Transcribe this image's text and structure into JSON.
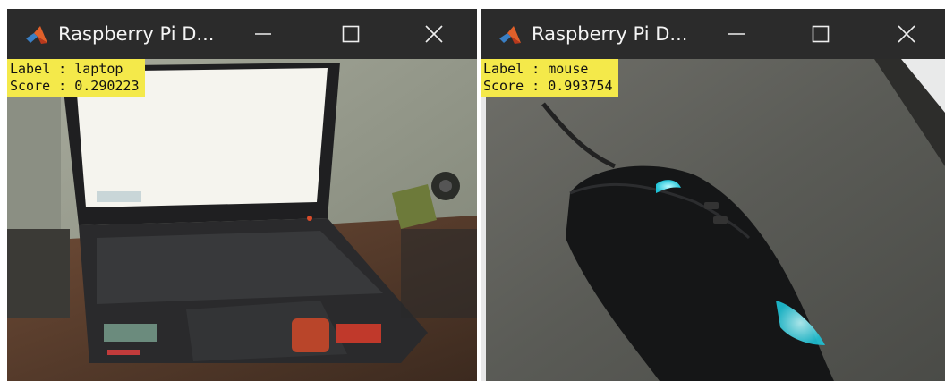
{
  "windows": [
    {
      "title": "Raspberry Pi D...",
      "detection": {
        "label_key": "Label",
        "label_value": "laptop",
        "score_key": "Score",
        "score_value": "0.290223"
      }
    },
    {
      "title": "Raspberry Pi D...",
      "detection": {
        "label_key": "Label",
        "label_value": "mouse",
        "score_key": "Score",
        "score_value": "0.993754"
      }
    }
  ],
  "icons": {
    "app": "matlab-icon",
    "minimize": "minimize-icon",
    "maximize": "maximize-icon",
    "close": "close-icon"
  },
  "colors": {
    "titlebar": "#2b2b2b",
    "overlay": "#f4e94a",
    "title_text": "#f4f4f4"
  }
}
